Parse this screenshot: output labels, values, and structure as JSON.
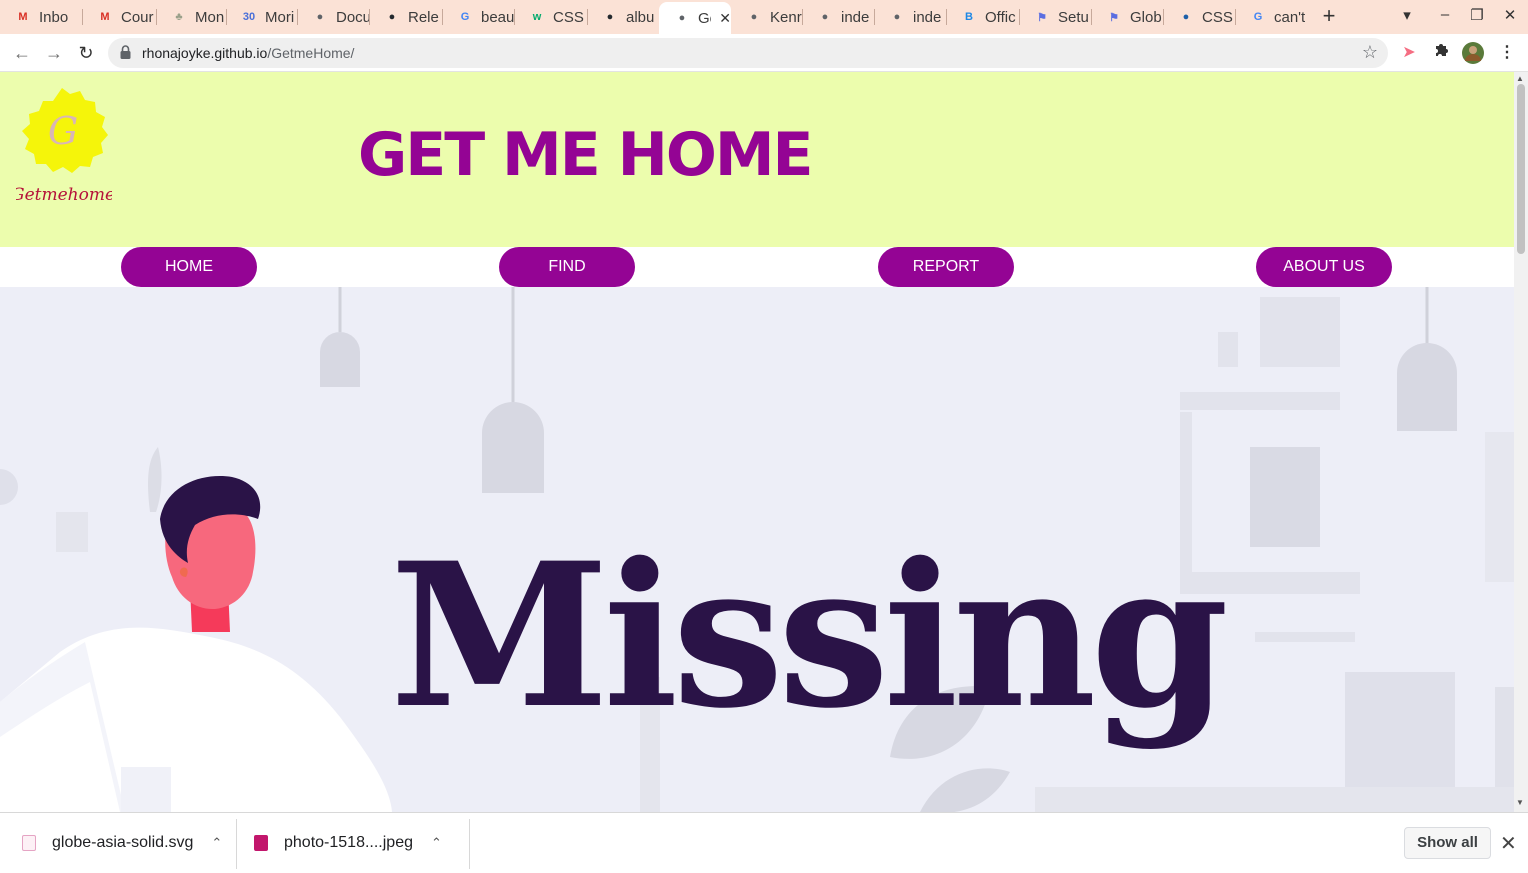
{
  "browser": {
    "tabs": [
      {
        "title": "Inbo",
        "icon": "gmail-icon",
        "glyph": "M",
        "color": "#d93025"
      },
      {
        "title": "Cour",
        "icon": "gmail-icon",
        "glyph": "M",
        "color": "#d93025"
      },
      {
        "title": "Mon",
        "icon": "tree-icon",
        "glyph": "♣",
        "color": "#9aa08a"
      },
      {
        "title": "Mori",
        "icon": "calendar-icon",
        "glyph": "30",
        "color": "#4a6fd8"
      },
      {
        "title": "Docu",
        "icon": "globe-icon",
        "glyph": "●",
        "color": "#5f6368"
      },
      {
        "title": "Rele",
        "icon": "github-icon",
        "glyph": "●",
        "color": "#24292e"
      },
      {
        "title": "beau",
        "icon": "google-icon",
        "glyph": "G",
        "color": "#4285f4"
      },
      {
        "title": "CSS (",
        "icon": "w3schools-icon",
        "glyph": "w",
        "color": "#04aa6d"
      },
      {
        "title": "albu",
        "icon": "github-icon",
        "glyph": "●",
        "color": "#24292e"
      },
      {
        "title": "Ge",
        "icon": "globe-icon",
        "glyph": "●",
        "color": "#5f6368",
        "active": true
      },
      {
        "title": "Kenr",
        "icon": "globe-icon",
        "glyph": "●",
        "color": "#5f6368"
      },
      {
        "title": "inde",
        "icon": "globe-icon",
        "glyph": "●",
        "color": "#5f6368"
      },
      {
        "title": "inde",
        "icon": "globe-icon",
        "glyph": "●",
        "color": "#5f6368"
      },
      {
        "title": "Offic",
        "icon": "bootstrap-icon",
        "glyph": "B",
        "color": "#1e88e5"
      },
      {
        "title": "Setu",
        "icon": "flag-icon",
        "glyph": "⚑",
        "color": "#5b6ee1"
      },
      {
        "title": "Glob",
        "icon": "flag-icon",
        "glyph": "⚑",
        "color": "#5b6ee1"
      },
      {
        "title": "CSS (",
        "icon": "edge-icon",
        "glyph": "●",
        "color": "#1d5fa8"
      },
      {
        "title": "can't",
        "icon": "google-icon",
        "glyph": "G",
        "color": "#4285f4"
      }
    ],
    "tab_close_glyph": "✕",
    "new_tab_glyph": "+",
    "address": {
      "host": "rhonajoyke.github.io",
      "path": "/GetmeHome/"
    },
    "window_controls": {
      "search_tabs": "▾",
      "minimize": "–",
      "restore": "❐",
      "close": "✕"
    }
  },
  "site": {
    "logo_text": "Getmehome",
    "logo_letter": "G",
    "title": "GET ME HOME",
    "nav": [
      "HOME",
      "FIND",
      "REPORT",
      "ABOUT US"
    ],
    "hero_text": "Missing",
    "colors": {
      "header_bg": "#ecfdad",
      "accent": "#940494",
      "hero_text": "#2a1347",
      "hero_bg": "#edeef7"
    }
  },
  "downloads": {
    "items": [
      {
        "name": "globe-asia-solid.svg",
        "icon_color": "#e5a4c4"
      },
      {
        "name": "photo-1518....jpeg",
        "icon_color": "#c2166c"
      }
    ],
    "show_all_label": "Show all",
    "close_glyph": "✕"
  }
}
